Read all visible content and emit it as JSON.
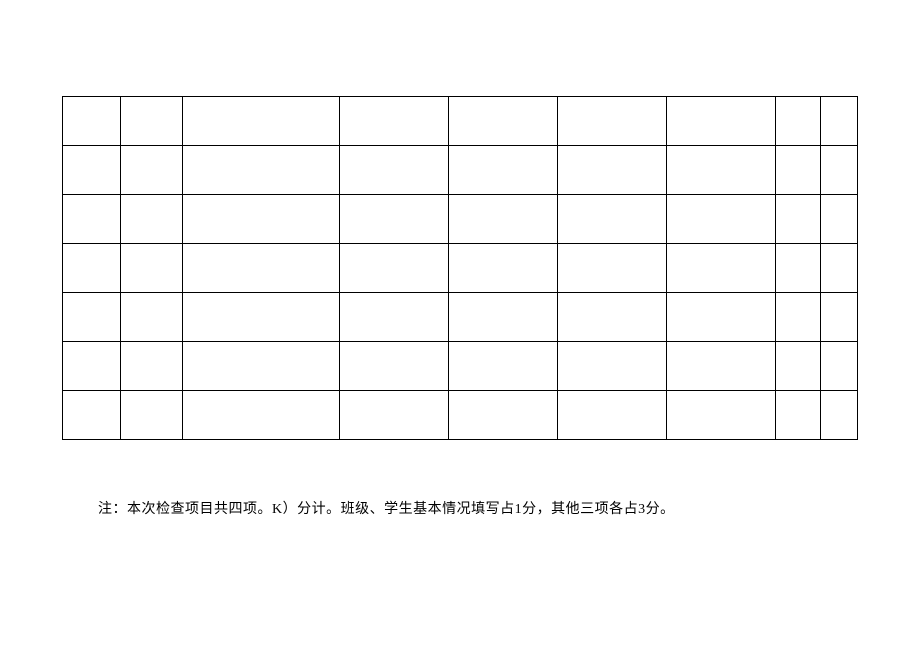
{
  "table": {
    "rows": 7,
    "columns": 9,
    "cells": []
  },
  "note": {
    "text": "注：本次检查项目共四项。K）分计。班级、学生基本情况填写占1分，其他三项各占3分。"
  }
}
